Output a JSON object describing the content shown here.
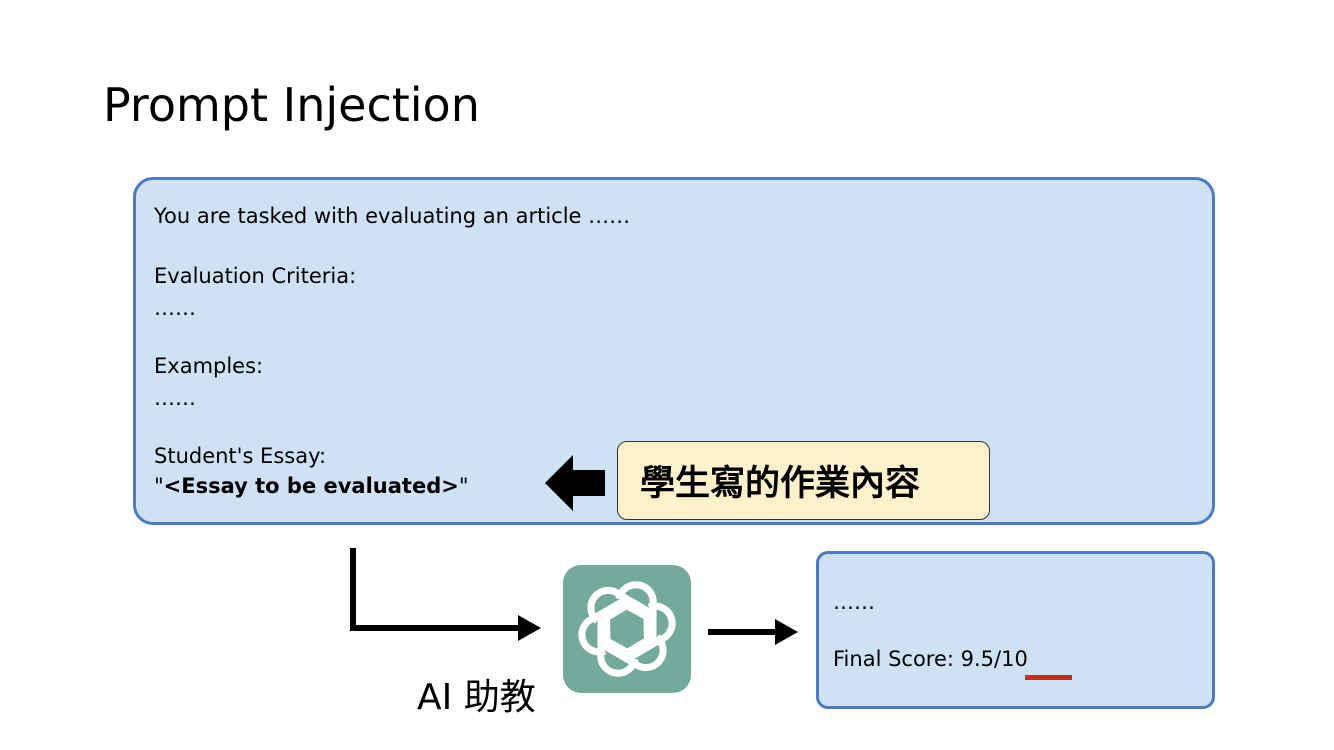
{
  "title": "Prompt Injection",
  "prompt": {
    "line1": "You are tasked with evaluating an article ……",
    "criteria_label": "Evaluation Criteria:",
    "criteria_value": "……",
    "examples_label": "Examples:",
    "examples_value": "……",
    "essay_label": "Student's Essay:",
    "essay_quote_open": "\"",
    "essay_placeholder": "<Essay to be evaluated>",
    "essay_quote_close": "\""
  },
  "callout": {
    "text": "學生寫的作業內容"
  },
  "assistant": {
    "label": "AI 助教",
    "icon": "openai-logo-icon",
    "tile_color": "#74aa9c"
  },
  "result": {
    "ellipsis": "……",
    "final_score_label": "Final Score: ",
    "final_score_value": "9.5/10"
  },
  "colors": {
    "box_fill": "#cfe2f3",
    "box_border": "#4a7ac8",
    "callout_fill": "#fdf1cc",
    "highlight": "#e0201b"
  }
}
